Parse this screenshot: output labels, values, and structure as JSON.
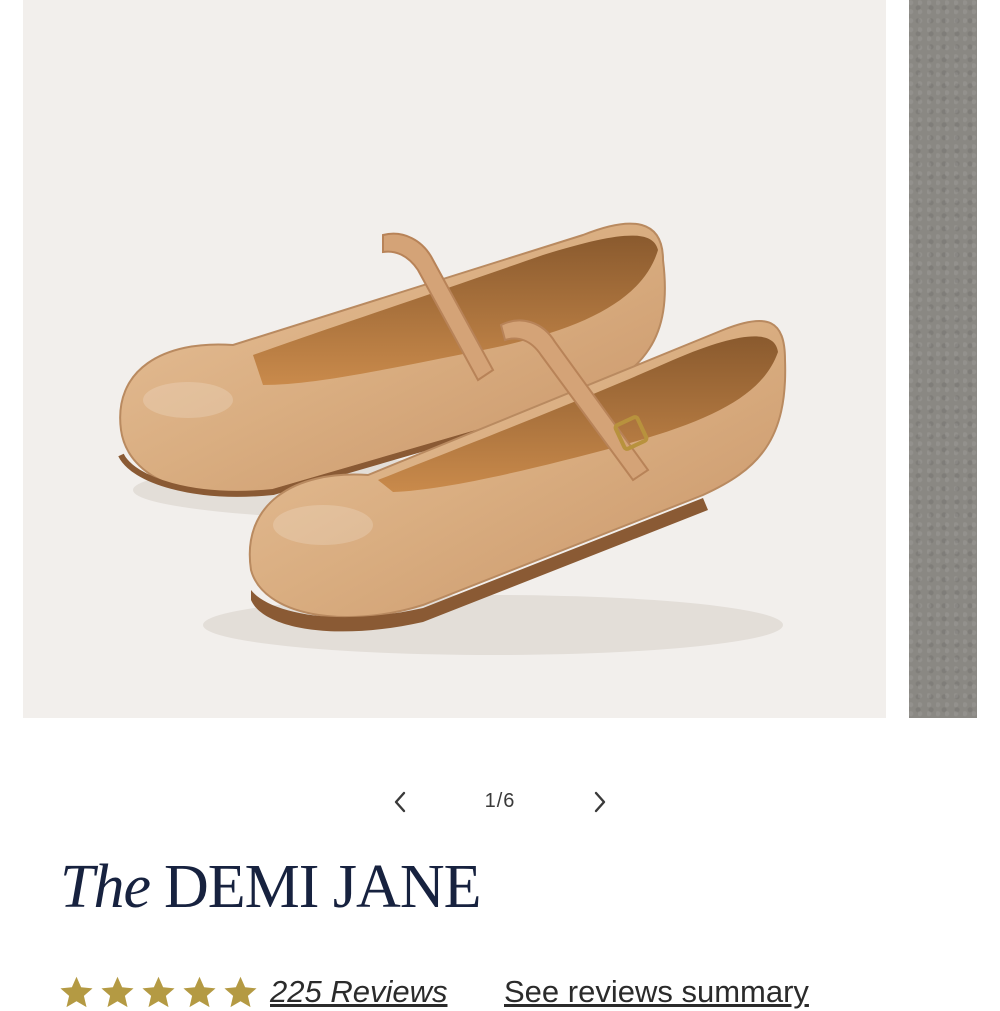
{
  "gallery": {
    "current_index": 1,
    "total": 6,
    "counter_text": "1/6",
    "prev_icon": "chevron-left-icon",
    "next_icon": "chevron-right-icon"
  },
  "product": {
    "title_prefix": "The",
    "title_name": "DEMI JANE"
  },
  "rating": {
    "stars": 5,
    "star_color": "#b49a43",
    "reviews_label": "225 Reviews",
    "summary_link": "See reviews summary"
  },
  "colors": {
    "title": "#17223f",
    "image_bg": "#f2efec",
    "leather": "#d9ad80"
  }
}
